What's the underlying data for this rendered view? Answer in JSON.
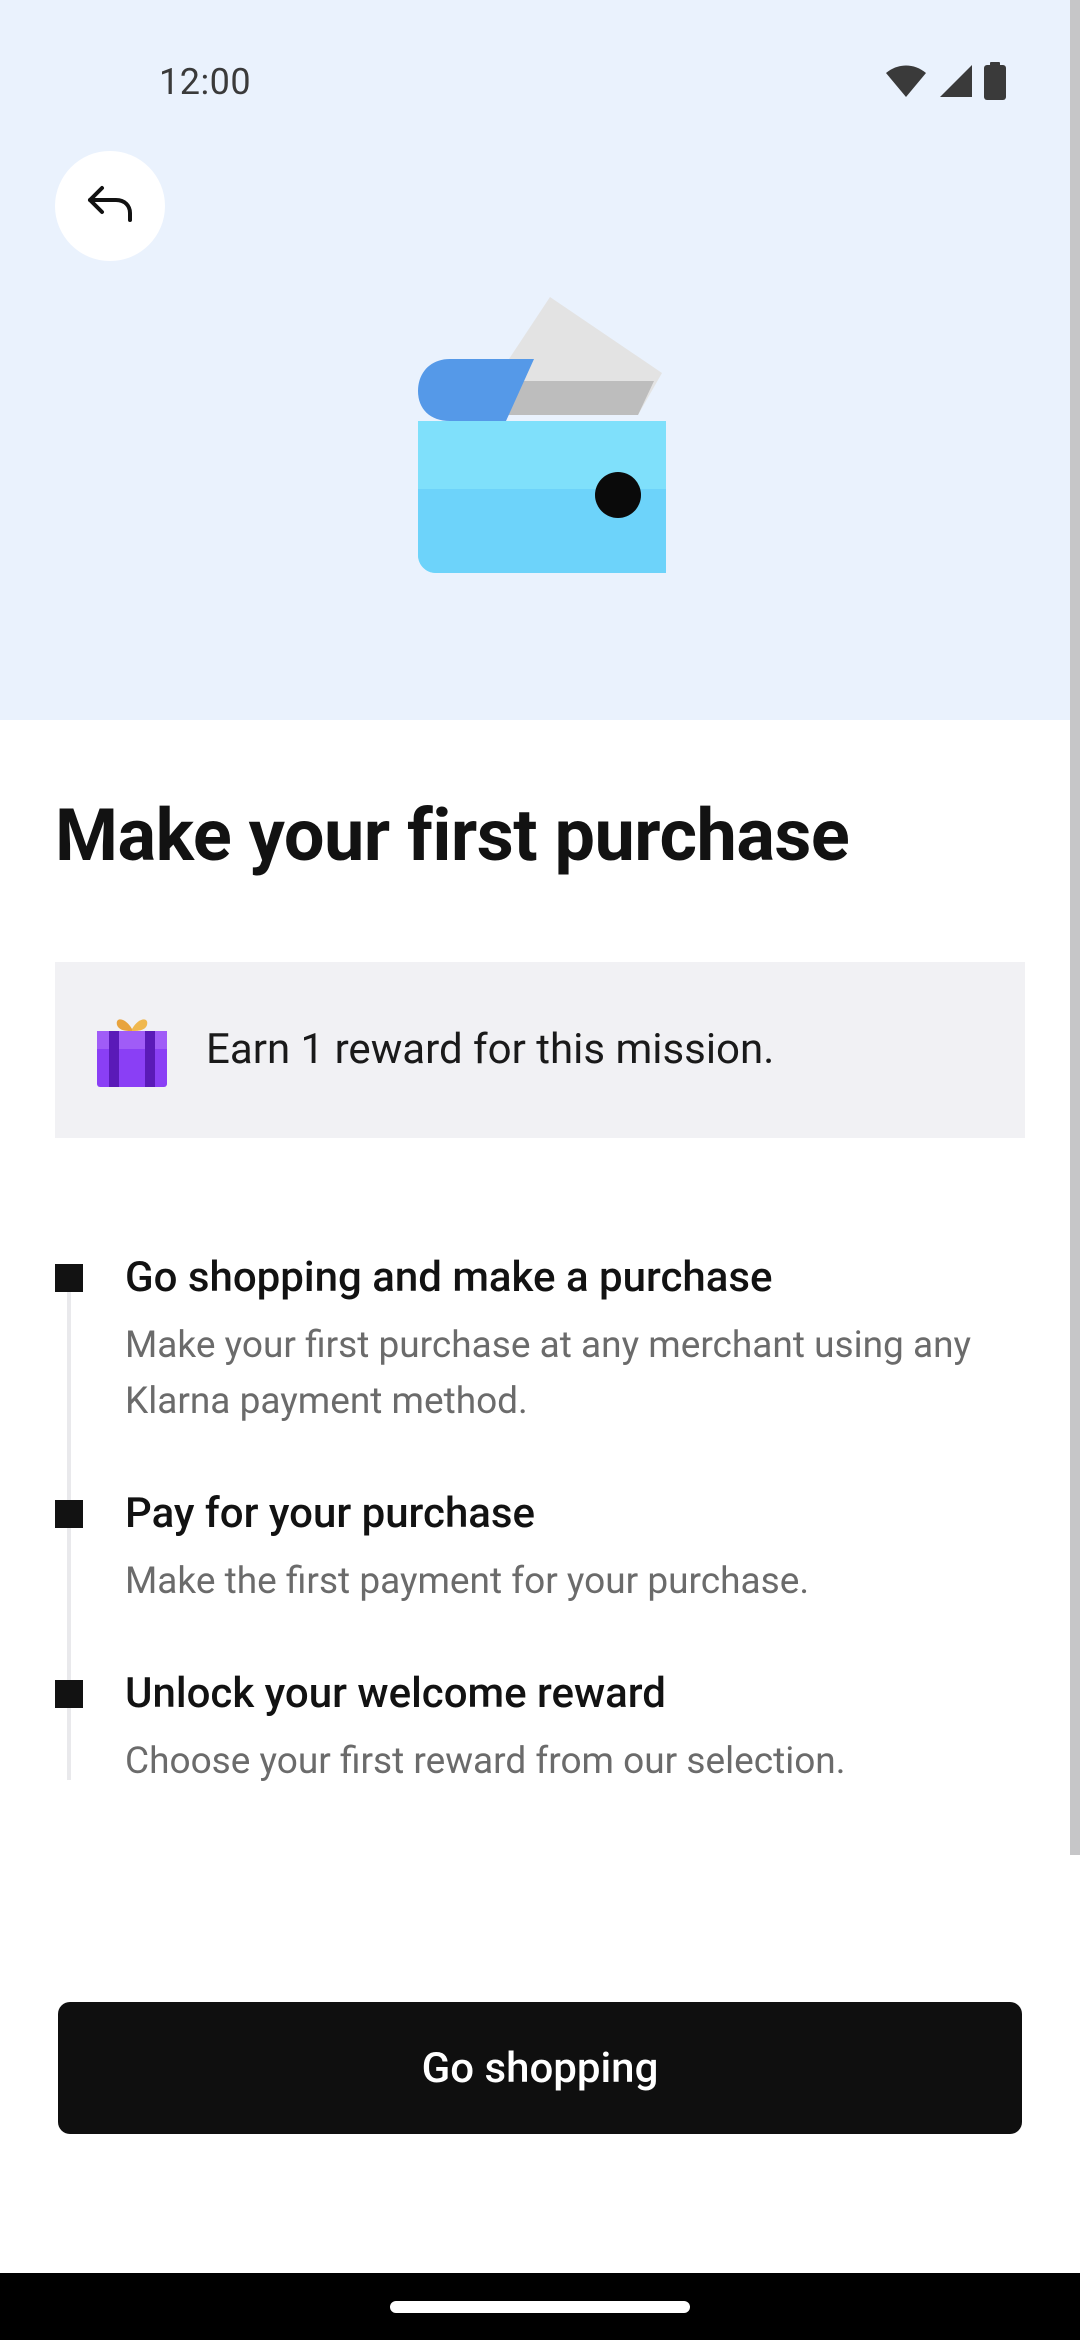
{
  "status_bar": {
    "time": "12:00",
    "icons": [
      "wifi-icon",
      "signal-icon",
      "battery-icon"
    ]
  },
  "header": {
    "back_icon": "back-arrow-icon",
    "illustration": "wallet-illustration"
  },
  "main": {
    "title": "Make your first purchase",
    "reward": {
      "icon": "gift-icon",
      "text": "Earn 1 reward for this mission."
    },
    "steps": [
      {
        "title": "Go shopping and make a purchase",
        "description": "Make your first purchase at any merchant using any Klarna payment method."
      },
      {
        "title": "Pay for your purchase",
        "description": "Make the first payment for your purchase."
      },
      {
        "title": "Unlock your welcome reward",
        "description": "Choose your first reward from our selection."
      }
    ],
    "cta_label": "Go shopping"
  },
  "colors": {
    "hero_background": "#eaf2fd",
    "card_background": "#f1f1f4",
    "primary_button": "#0f0f0f",
    "wallet_light": "#6dd3fa",
    "wallet_dark": "#5599e8",
    "gift_purple": "#7b2cf0"
  }
}
